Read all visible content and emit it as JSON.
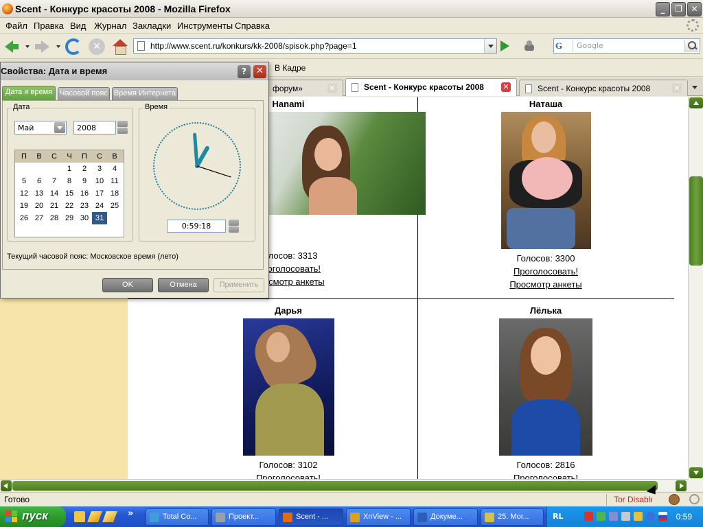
{
  "window": {
    "title": "Scent - Конкурс красоты 2008 - Mozilla Firefox"
  },
  "menu": {
    "items": [
      "Файл",
      "Правка",
      "Вид",
      "Журнал",
      "Закладки",
      "Инструменты",
      "Справка"
    ]
  },
  "nav": {
    "url": "http://www.scent.ru/konkurs/kk-2008/spisok.php?page=1",
    "search_placeholder": "Google",
    "search_engine_glyph": "G"
  },
  "bookmarks": {
    "item": "В Кадре"
  },
  "tabs": [
    {
      "label": "форум»",
      "active": false
    },
    {
      "label": "Scent - Конкурс красоты 2008",
      "active": true
    },
    {
      "label": "Scent - Конкурс красоты 2008",
      "active": false
    }
  ],
  "contest": {
    "cards": [
      {
        "name": "Hanami",
        "votes": "Голосов: 3313",
        "vote_link": "Проголосовать!",
        "view_link": "Просмотр анкеты"
      },
      {
        "name": "Наташа",
        "votes": "Голосов: 3300",
        "vote_link": "Проголосовать!",
        "view_link": "Просмотр анкеты"
      },
      {
        "name": "Дарья",
        "votes": "Голосов: 3102",
        "vote_link": "Проголосовать!",
        "view_link": ""
      },
      {
        "name": "Лёлька",
        "votes": "Голосов: 2816",
        "vote_link": "Проголосовать!",
        "view_link": ""
      }
    ]
  },
  "status": {
    "text": "Готово",
    "tor": "Tor Disabled"
  },
  "taskbar": {
    "start": "пуск",
    "tasks": [
      {
        "label": "Total Co...",
        "color": "#3e9fd6"
      },
      {
        "label": "Проект...",
        "color": "#9aa0a8"
      },
      {
        "label": "Scent - ...",
        "color": "#e46a10"
      },
      {
        "label": "XnView - ...",
        "color": "#d8a024"
      },
      {
        "label": "Докуме...",
        "color": "#2a5fb8"
      },
      {
        "label": "25. Мог...",
        "color": "#d8c040"
      }
    ],
    "lang": "RL",
    "clock": "0:59"
  },
  "dialog": {
    "title": "Свойства: Дата и время",
    "help_glyph": "?",
    "close_glyph": "✕",
    "tabs": [
      "Дата и время",
      "Часовой пояс",
      "Время Интернета"
    ],
    "date_group": "Дата",
    "time_group": "Время",
    "month": "Май",
    "year": "2008",
    "weekdays": [
      "П",
      "В",
      "С",
      "Ч",
      "П",
      "С",
      "В"
    ],
    "days": [
      "1",
      "2",
      "3",
      "4",
      "5",
      "6",
      "7",
      "8",
      "9",
      "10",
      "11",
      "12",
      "13",
      "14",
      "15",
      "16",
      "17",
      "18",
      "19",
      "20",
      "21",
      "22",
      "23",
      "24",
      "25",
      "26",
      "27",
      "28",
      "29",
      "30",
      "31"
    ],
    "first_day_col": 3,
    "selected_day": "31",
    "time": "0:59:18",
    "time_hms": [
      0,
      59,
      18
    ],
    "timezone": "Текущий часовой пояс: Московское время (лето)",
    "buttons": {
      "ok": "OK",
      "cancel": "Отмена",
      "apply": "Применить"
    }
  }
}
